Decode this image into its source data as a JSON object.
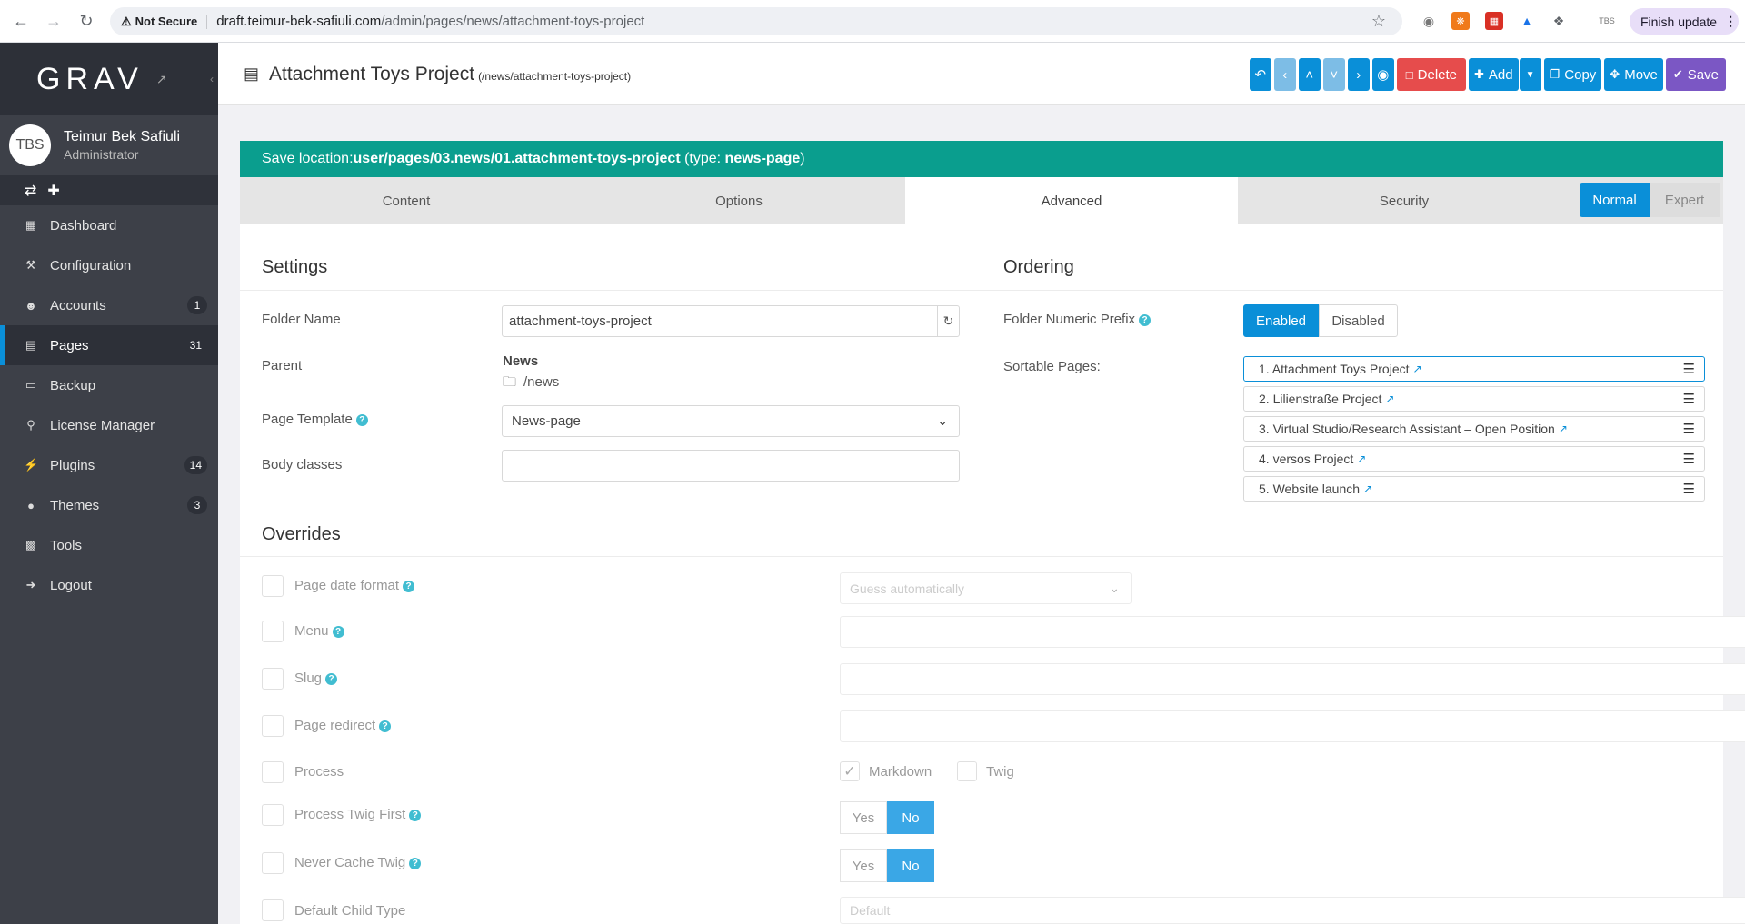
{
  "browser": {
    "not_secure": "Not Secure",
    "url_host": "draft.teimur-bek-safiuli.com",
    "url_path": "/admin/pages/news/attachment-toys-project",
    "finish_update": "Finish update",
    "profile": "TBS"
  },
  "sidebar": {
    "logo": "GRAV",
    "user": {
      "initials": "TBS",
      "name": "Teimur Bek Safiuli",
      "role": "Administrator"
    },
    "items": [
      {
        "label": "Dashboard",
        "icon": "dashboard-icon",
        "badge": ""
      },
      {
        "label": "Configuration",
        "icon": "wrench-icon",
        "badge": ""
      },
      {
        "label": "Accounts",
        "icon": "users-icon",
        "badge": "1"
      },
      {
        "label": "Pages",
        "icon": "file-icon",
        "badge": "31"
      },
      {
        "label": "Backup",
        "icon": "hdd-icon",
        "badge": ""
      },
      {
        "label": "License Manager",
        "icon": "key-icon",
        "badge": ""
      },
      {
        "label": "Plugins",
        "icon": "plug-icon",
        "badge": "14"
      },
      {
        "label": "Themes",
        "icon": "tint-icon",
        "badge": "3"
      },
      {
        "label": "Tools",
        "icon": "briefcase-icon",
        "badge": ""
      },
      {
        "label": "Logout",
        "icon": "sign-out-icon",
        "badge": ""
      }
    ]
  },
  "header": {
    "title": "Attachment Toys Project",
    "route": "(/news/attachment-toys-project)",
    "delete": "Delete",
    "add": "Add",
    "copy": "Copy",
    "move": "Move",
    "save": "Save"
  },
  "save_location": {
    "prefix": "Save location: ",
    "path": "user/pages/03.news/01.attachment-toys-project",
    "type_prefix": " (type: ",
    "type": "news-page",
    "type_suffix": ")"
  },
  "tabs": [
    "Content",
    "Options",
    "Advanced",
    "Security"
  ],
  "mode": {
    "normal": "Normal",
    "expert": "Expert"
  },
  "settings": {
    "title": "Settings",
    "folder_name_label": "Folder Name",
    "folder_name_value": "attachment-toys-project",
    "parent_label": "Parent",
    "parent_name": "News",
    "parent_route": "/news",
    "template_label": "Page Template",
    "template_value": "News-page",
    "body_classes_label": "Body classes",
    "body_classes_value": ""
  },
  "ordering": {
    "title": "Ordering",
    "prefix_label": "Folder Numeric Prefix",
    "enabled": "Enabled",
    "disabled": "Disabled",
    "sortable_label": "Sortable Pages:",
    "pages": [
      "1. Attachment Toys Project",
      "2. Lilienstraße Project",
      "3. Virtual Studio/Research Assistant – Open Position",
      "4. versos Project",
      "5. Website launch"
    ]
  },
  "overrides": {
    "title": "Overrides",
    "date_format_label": "Page date format",
    "date_format_value": "Guess automatically",
    "menu_label": "Menu",
    "slug_label": "Slug",
    "redirect_label": "Page redirect",
    "process_label": "Process",
    "markdown": "Markdown",
    "twig": "Twig",
    "twig_first_label": "Process Twig First",
    "never_cache_label": "Never Cache Twig",
    "yes": "Yes",
    "no": "No",
    "child_type_label": "Default Child Type",
    "child_type_value": "Default"
  }
}
